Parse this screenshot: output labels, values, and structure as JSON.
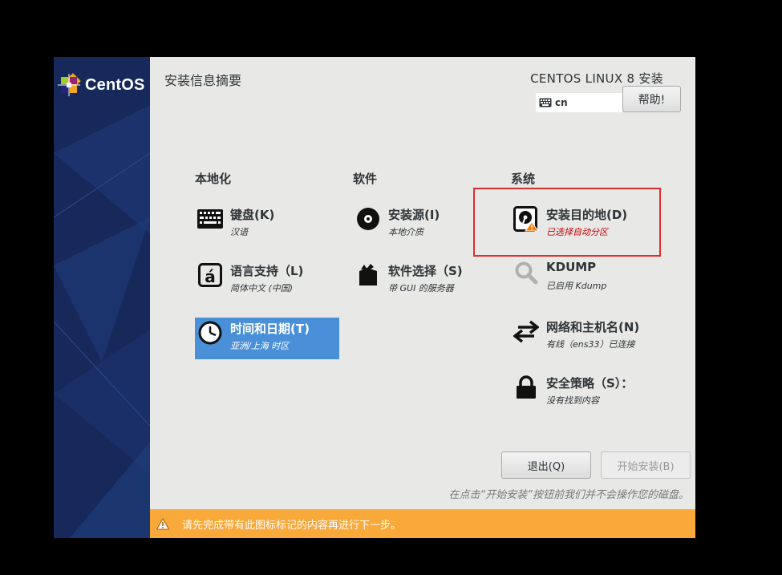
{
  "logo": {
    "text": "CentOS"
  },
  "header": {
    "page_title": "安装信息摘要",
    "product_title": "CENTOS LINUX 8 安装",
    "keyboard_layout": "cn",
    "help_label": "帮助!"
  },
  "categories": {
    "localization": "本地化",
    "software": "软件",
    "system": "系统"
  },
  "spokes": {
    "keyboard": {
      "name": "键盘(K)",
      "status": "汉语",
      "icon": "keyboard-icon"
    },
    "language": {
      "name": "语言支持（L)",
      "status": "简体中文 (中国)",
      "icon": "language-icon"
    },
    "datetime": {
      "name": "时间和日期(T)",
      "status": "亚洲/上海 时区",
      "icon": "clock-icon"
    },
    "source": {
      "name": "安装源(I)",
      "status": "本地介质",
      "icon": "disc-icon"
    },
    "software": {
      "name": "软件选择（S)",
      "status": "带 GUI 的服务器",
      "icon": "package-icon"
    },
    "destination": {
      "name": "安装目的地(D)",
      "status": "已选择自动分区",
      "icon": "harddisk-warning-icon"
    },
    "kdump": {
      "name": "KDUMP",
      "status": "已启用 Kdump",
      "icon": "magnifier-icon"
    },
    "network": {
      "name": "网络和主机名(N)",
      "status": "有线（ens33）已连接",
      "icon": "network-arrows-icon"
    },
    "security": {
      "name": "安全策略（S）：",
      "status": "没有找到内容",
      "icon": "lock-icon"
    }
  },
  "footer": {
    "quit_label": "退出(Q)",
    "begin_label": "开始安装(B)",
    "note": "在点击“开始安装”按钮前我们并不会操作您的磁盘。",
    "warning": "请先完成带有此图标标记的内容再进行下一步。"
  },
  "colors": {
    "sidebar": "#16295a",
    "selected": "#4a90d9",
    "warning_bar": "#f9a93a",
    "highlight": "#e0302a",
    "status_warn": "#cc0000"
  }
}
